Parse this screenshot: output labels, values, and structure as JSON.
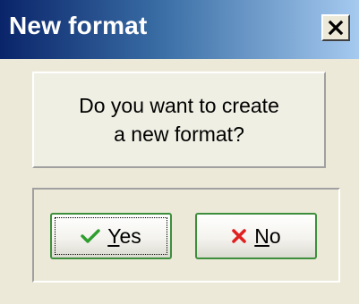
{
  "window": {
    "title": "New format",
    "close_icon": "close-icon"
  },
  "message": {
    "line1": "Do you want to create",
    "line2": "a new format?"
  },
  "buttons": {
    "yes": {
      "mnemonic": "Y",
      "rest": "es",
      "icon": "checkmark-icon",
      "icon_color": "#2e9e2e"
    },
    "no": {
      "mnemonic": "N",
      "rest": "o",
      "icon": "red-x-icon",
      "icon_color": "#e02020"
    }
  },
  "colors": {
    "titlebar_start": "#0a246a",
    "titlebar_end": "#a6caf0",
    "button_border": "#3d8f3d"
  }
}
